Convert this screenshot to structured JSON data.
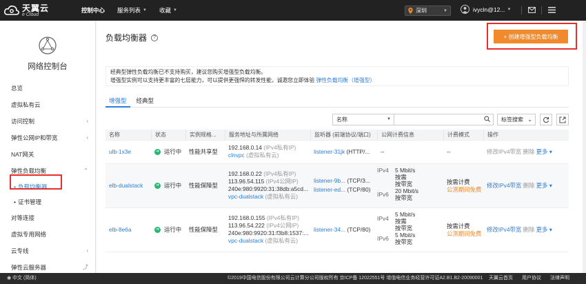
{
  "topbar": {
    "logo_main": "天翼云",
    "logo_sub": "e Cloud",
    "nav": [
      {
        "label": "控制中心",
        "active": true,
        "dropdown": false
      },
      {
        "label": "服务列表",
        "active": false,
        "dropdown": true
      },
      {
        "label": "收藏",
        "active": false,
        "dropdown": true
      }
    ],
    "region": "深圳",
    "username": "ivycln@12...",
    "icons": [
      "location-pin-icon",
      "avatar",
      "mail-icon",
      "menu-icon"
    ]
  },
  "sidebar": {
    "title": "网络控制台",
    "items": [
      {
        "label": "总览"
      },
      {
        "label": "虚拟私有云"
      },
      {
        "label": "访问控制",
        "expandable": true
      },
      {
        "label": "弹性公网IP和带宽",
        "expandable": true
      },
      {
        "label": "NAT网关"
      },
      {
        "label": "弹性负载均衡",
        "expanded": true,
        "children": [
          {
            "label": "负载均衡器",
            "active": true
          },
          {
            "label": "证书管理"
          }
        ]
      },
      {
        "label": "对等连接"
      },
      {
        "label": "虚拟专用网络"
      },
      {
        "label": "云专线",
        "expandable": true
      },
      {
        "label": "弹性云服务器",
        "external": true
      }
    ]
  },
  "main": {
    "title": "负载均衡器",
    "create_button": "+ 创建增强型负载均衡",
    "notice_line1": "经典型弹性负载均衡已不支持购买，建议您购买增强型负载均衡。",
    "notice_line2": "增强型实例可以支持更丰富的七层能力，可以提供更强悍的转发性能，诚邀您立即体验",
    "notice_link": "弹性负载均衡（增强型）",
    "tabs": [
      {
        "label": "增强型",
        "active": true
      },
      {
        "label": "经典型",
        "active": false
      }
    ],
    "filter": {
      "selected": "名称",
      "placeholder": ""
    },
    "tag_search": "标签搜索",
    "table": {
      "headers": [
        "名称",
        "状态",
        "实例规格...",
        "服务地址与所属网络",
        "监听器 (前端协议/端口)",
        "公网计费信息",
        "计费模式",
        "操作"
      ],
      "rows": [
        {
          "name": "ulb-1x3e",
          "status": "运行中",
          "spec": "性能共享型",
          "addr": [
            {
              "ip": "192.168.0.14",
              "note": "(IPv4私有IP)"
            }
          ],
          "vpc": "clnvpc",
          "vpc_note": "(虚拟私有云)",
          "listeners": [
            {
              "name": "listener-31jk",
              "proto": "(HTTP/..."
            }
          ],
          "bandwidth": [],
          "bandwidth_empty": "--",
          "billing": [],
          "billing_empty": "--",
          "action": "修改IPv4带宽",
          "delete": "删除",
          "more": "更多 ▾"
        },
        {
          "name": "elb-dualstack",
          "status": "运行中",
          "spec": "性能保障型",
          "addr": [
            {
              "ip": "192.168.0.22",
              "note": "(IPv4私有IP)"
            },
            {
              "ip": "113.96.54.115",
              "note": "(IPv4公网IP)"
            },
            {
              "ip": "240e:980:9920:31:38db:a5cd...",
              "note": ""
            }
          ],
          "vpc": "vpc-dualstack",
          "vpc_note": "(虚拟私有云)",
          "listeners": [
            {
              "name": "listener-9b...",
              "proto": "(TCP/3..."
            },
            {
              "name": "listener-ed...",
              "proto": "(TCP/80)"
            }
          ],
          "bandwidth": [
            {
              "type": "IPv4",
              "speed": "5 Mbit/s",
              "mode": "按需",
              "mode2": "按带宽"
            },
            {
              "type": "IPv6",
              "speed": "20 Mbit/s",
              "mode": "按需",
              "mode2": "按带宽"
            }
          ],
          "billing": [
            "按需计费",
            "公测期间免费"
          ],
          "action": "修改IPv4带宽",
          "delete": "删除",
          "more": "更多 ▾"
        },
        {
          "name": "elb-8e6a",
          "status": "运行中",
          "spec": "性能保障型",
          "addr": [
            {
              "ip": "192.168.0.155",
              "note": "(IPv4私有IP)"
            },
            {
              "ip": "113.96.54.222",
              "note": "(IPv4公网IP)"
            },
            {
              "ip": "240e:980:9920:31:f3b8:1537:...",
              "note": ""
            }
          ],
          "vpc": "vpc-dualstack",
          "vpc_note": "(虚拟私有云)",
          "listeners": [
            {
              "name": "listener-34...",
              "proto": "(TCP/80)"
            }
          ],
          "bandwidth": [
            {
              "type": "IPv4",
              "speed": "5 Mbit/s",
              "mode": "按需",
              "mode2": "按带宽"
            },
            {
              "type": "IPv6",
              "speed": "5 Mbit/s",
              "mode": "按需",
              "mode2": "按带宽"
            }
          ],
          "billing": [
            "按需计费",
            "公测期间免费"
          ],
          "action": "修改IPv4带宽",
          "delete": "删除",
          "more": "更多 ▾"
        }
      ]
    }
  },
  "footer": {
    "lang": "中文 (简体)",
    "copyright": "©2019中国电信股份有限公司云计算分公司版权所有 京ICP备 12022551号 增值电信业务经营许可证A2.B1.B2-20090001",
    "links": [
      "天翼云首页",
      "用户协议",
      "法律声明"
    ]
  },
  "colors": {
    "accent": "#2d7ed8",
    "orange": "#f08a2c",
    "highlight": "#e62e2e",
    "topbar": "#222222"
  }
}
